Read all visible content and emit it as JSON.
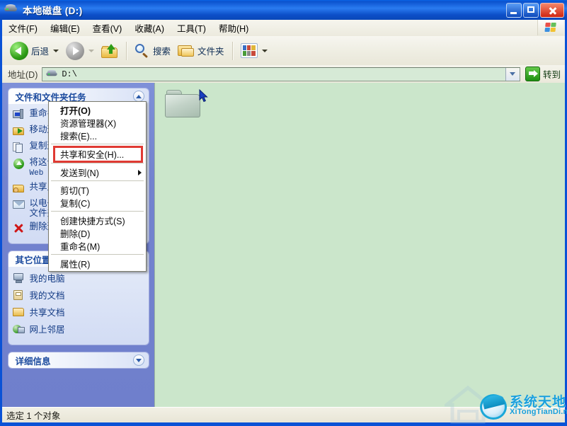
{
  "window": {
    "title": "本地磁盘 (D:)",
    "icon": "drive-icon",
    "controls": {
      "minimize": "minimize-button",
      "maximize": "maximize-button",
      "close": "close-button"
    }
  },
  "menubar": {
    "items": [
      {
        "label": "文件(F)",
        "name": "menu-file"
      },
      {
        "label": "编辑(E)",
        "name": "menu-edit"
      },
      {
        "label": "查看(V)",
        "name": "menu-view"
      },
      {
        "label": "收藏(A)",
        "name": "menu-favorites"
      },
      {
        "label": "工具(T)",
        "name": "menu-tools"
      },
      {
        "label": "帮助(H)",
        "name": "menu-help"
      }
    ],
    "brand_icon": "windows-flag-icon"
  },
  "toolbar": {
    "back_label": "后退",
    "forward_label": "",
    "up_label": "",
    "search_label": "搜索",
    "folders_label": "文件夹",
    "views_label": ""
  },
  "address": {
    "label": "地址(D)",
    "value": "D:\\",
    "go_label": "转到"
  },
  "sidebar": {
    "tasks_panel": {
      "title": "文件和文件夹任务",
      "collapse_state": "expanded",
      "items": [
        {
          "label": "重命名这个文件夹",
          "icon": "rename-icon"
        },
        {
          "label": "移动这个文件夹",
          "icon": "move-icon"
        },
        {
          "label": "复制这个文件夹",
          "icon": "copy-icon"
        },
        {
          "label": "将这个文件夹发布到",
          "sub": "Web",
          "icon": "publish-web-icon"
        },
        {
          "label": "共享此文件夹",
          "icon": "share-folder-icon"
        },
        {
          "label": "以电子邮件形式发送该",
          "label2": "文件夹内的文件",
          "icon": "email-icon"
        },
        {
          "label": "删除这个文件夹",
          "icon": "delete-icon"
        }
      ]
    },
    "places_panel": {
      "title": "其它位置",
      "collapse_state": "expanded",
      "items": [
        {
          "label": "我的电脑",
          "icon": "my-computer-icon"
        },
        {
          "label": "我的文档",
          "icon": "my-documents-icon"
        },
        {
          "label": "共享文档",
          "icon": "shared-documents-icon"
        },
        {
          "label": "网上邻居",
          "icon": "network-places-icon"
        }
      ]
    },
    "details_panel": {
      "title": "详细信息",
      "collapse_state": "collapsed"
    }
  },
  "content": {
    "items": [
      {
        "name": "folder-item",
        "selected": true,
        "label": ""
      }
    ]
  },
  "context_menu": {
    "items": [
      {
        "label": "打开(O)",
        "bold": true,
        "name": "ctx-open"
      },
      {
        "label": "资源管理器(X)",
        "bold": false,
        "name": "ctx-explore"
      },
      {
        "label": "搜索(E)...",
        "bold": false,
        "name": "ctx-search"
      },
      {
        "separator": true
      },
      {
        "label": "共享和安全(H)...",
        "bold": false,
        "name": "ctx-sharing-and-security",
        "highlighted": true
      },
      {
        "separator": true
      },
      {
        "label": "发送到(N)",
        "bold": false,
        "name": "ctx-send-to",
        "submenu": true
      },
      {
        "separator": true
      },
      {
        "label": "剪切(T)",
        "bold": false,
        "name": "ctx-cut"
      },
      {
        "label": "复制(C)",
        "bold": false,
        "name": "ctx-copy"
      },
      {
        "separator": true
      },
      {
        "label": "创建快捷方式(S)",
        "bold": false,
        "name": "ctx-create-shortcut"
      },
      {
        "label": "删除(D)",
        "bold": false,
        "name": "ctx-delete"
      },
      {
        "label": "重命名(M)",
        "bold": false,
        "name": "ctx-rename"
      },
      {
        "separator": true
      },
      {
        "label": "属性(R)",
        "bold": false,
        "name": "ctx-properties"
      }
    ],
    "highlight_color": "#E03A33"
  },
  "statusbar": {
    "text": "选定 1 个对象"
  },
  "watermark": {
    "chinese": "系统天地",
    "english": "XiTongTianDi.net"
  },
  "colors": {
    "titlebar": "#0B52CE",
    "sidebar": "#7383CF",
    "content": "#CBE6CB",
    "toolbar": "#EFEEE3",
    "accent_red": "#E03A33",
    "watermark_blue": "#1AA0DC"
  }
}
